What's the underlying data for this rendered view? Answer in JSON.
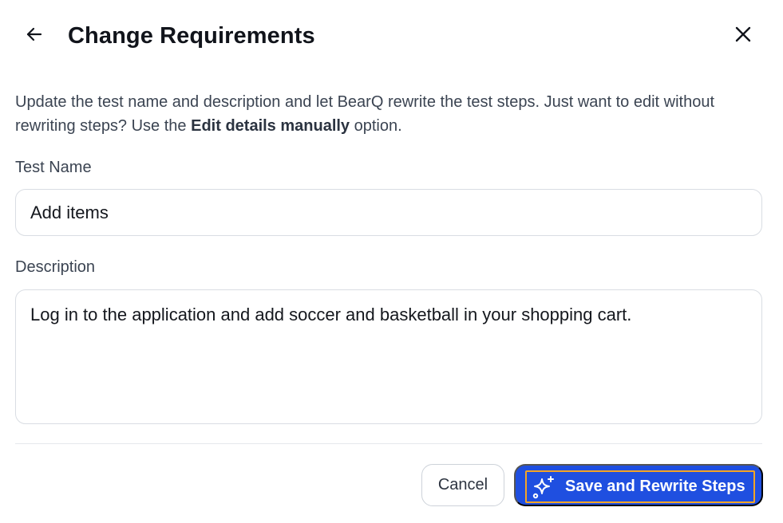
{
  "header": {
    "title": "Change Requirements",
    "back_icon": "arrow-left-icon",
    "close_icon": "close-icon"
  },
  "intro": {
    "text_before": "Update the test name and description and let BearQ rewrite the test steps. Just want to edit without rewriting steps? Use the ",
    "emphasis": "Edit details manually",
    "text_after": " option."
  },
  "form": {
    "name_label": "Test Name",
    "name_value": "Add items",
    "description_label": "Description",
    "description_value": "Log in to the application and add soccer and basketball in your shopping cart."
  },
  "footer": {
    "cancel_label": "Cancel",
    "save_label": "Save and Rewrite Steps",
    "save_icon": "sparkles-icon"
  },
  "colors": {
    "primary": "#1f4fe0",
    "focus_ring": "#f5a524",
    "border": "#d9dde3",
    "text": "#11141b"
  }
}
